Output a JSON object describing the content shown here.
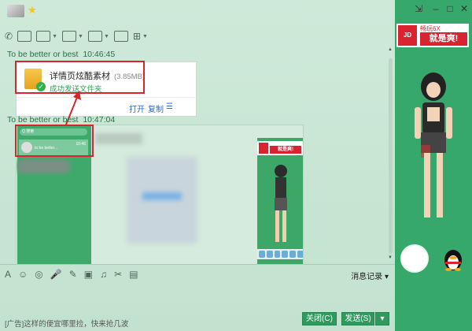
{
  "window": {
    "controls": {
      "pin": "⇲",
      "minimize": "–",
      "maximize": "□",
      "close": "✕"
    }
  },
  "toolbar_icons": [
    "phone-icon",
    "video-icon",
    "screen-share-icon",
    "file-transfer-icon",
    "remote-assist-icon",
    "app-icon",
    "more-icon"
  ],
  "messages": [
    {
      "sender": "To be better or best",
      "time": "10:46:45"
    },
    {
      "sender": "To be better or best",
      "time": "10:47:04"
    }
  ],
  "file_card": {
    "name": "详情页炫酷素材",
    "size": "(3.85MB)",
    "status": "成功发送文件夹",
    "open_label": "打开",
    "copy_label": "复制"
  },
  "embedded_screenshot": {
    "search_text": "Q 搜索",
    "item_text": "to be better...",
    "item_time": "10:46",
    "ad_top": "JD",
    "ad_text": "就是爽!"
  },
  "input_toolbar": {
    "icons": [
      "font-icon",
      "emoji-icon",
      "magic-emoji-icon",
      "voice-icon",
      "pen-icon",
      "image-icon",
      "music-icon",
      "scissors-icon",
      "file-icon"
    ],
    "history_label": "消息记录"
  },
  "footer": {
    "ad_text": "[广告]这样的便宜哪里捡，快来抢几波",
    "close_label": "关闭(C)",
    "send_label": "发送(S)"
  },
  "side_ad": {
    "logo": "JD",
    "top_text": "畅玩6X",
    "main_text": "就是爽!"
  },
  "colors": {
    "accent": "#2f9a5e",
    "side_bg": "#37a86b",
    "highlight": "#d9232d"
  }
}
